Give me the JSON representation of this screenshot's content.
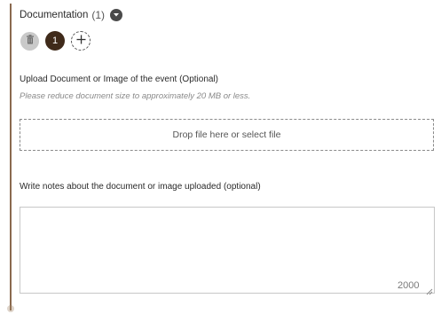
{
  "section": {
    "title": "Documentation",
    "count": "(1)",
    "chevron_icon": "chevron-down-icon"
  },
  "items": {
    "delete_icon": "trash-icon",
    "page_number": "1",
    "add_icon": "plus-icon"
  },
  "upload": {
    "label": "Upload Document or Image of the event (Optional)",
    "hint": "Please reduce document size to approximately 20 MB or less.",
    "dropzone_text": "Drop file here or select file"
  },
  "notes": {
    "label": "Write notes about the document or image uploaded (optional)",
    "value": "",
    "char_limit": "2000"
  },
  "colors": {
    "accent": "#3f2a1a",
    "rule": "#8a6a4f",
    "muted": "#8a8a8a"
  }
}
